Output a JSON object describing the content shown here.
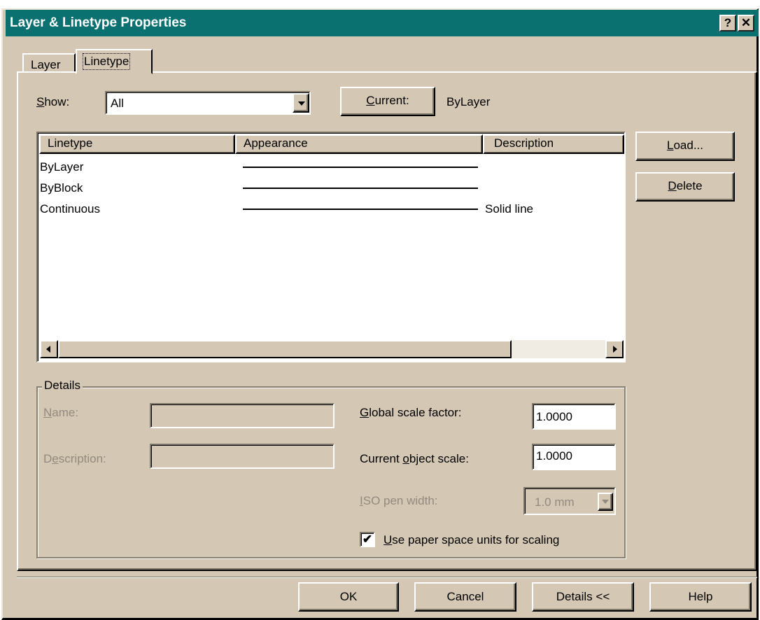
{
  "window": {
    "title": "Layer & Linetype Properties",
    "help_button": "?",
    "close_button": "✕"
  },
  "tabs": [
    {
      "label": "Layer",
      "active": false
    },
    {
      "label": "Linetype",
      "active": true
    }
  ],
  "show": {
    "label_pre": "",
    "label_underline": "S",
    "label_post": "how:",
    "value": "All"
  },
  "current": {
    "button_underline": "C",
    "button_post": "urrent:",
    "value": "ByLayer"
  },
  "linetype_list": {
    "columns": [
      "Linetype",
      "Appearance",
      "Description"
    ],
    "rows": [
      {
        "name": "ByLayer",
        "description": ""
      },
      {
        "name": "ByBlock",
        "description": ""
      },
      {
        "name": "Continuous",
        "description": "Solid line"
      }
    ]
  },
  "buttons": {
    "load_underline": "L",
    "load_post": "oad...",
    "delete_underline": "D",
    "delete_post": "elete",
    "ok": "OK",
    "cancel": "Cancel",
    "details": "Details <<",
    "help": "Help"
  },
  "details": {
    "group_title": "Details",
    "name_label_underline": "N",
    "name_label_post": "ame:",
    "name_value": "",
    "description_label_pre": "D",
    "description_label_underline": "e",
    "description_label_post": "scription:",
    "description_value": "",
    "global_scale_underline": "G",
    "global_scale_post": "lobal scale factor:",
    "global_scale_value": "1.0000",
    "object_scale_pre": "Current ",
    "object_scale_underline": "o",
    "object_scale_post": "bject scale:",
    "object_scale_value": "1.0000",
    "iso_pen_underline": "I",
    "iso_pen_post": "SO pen width:",
    "iso_pen_value": "1.0 mm",
    "paper_space_checked": true,
    "paper_space_check_glyph": "✔",
    "paper_space_underline": "U",
    "paper_space_post": "se paper space units for scaling"
  },
  "colors": {
    "title_bar": "#0a7070",
    "dialog_face": "#d4c8b4",
    "disabled_text": "#928a7e"
  }
}
